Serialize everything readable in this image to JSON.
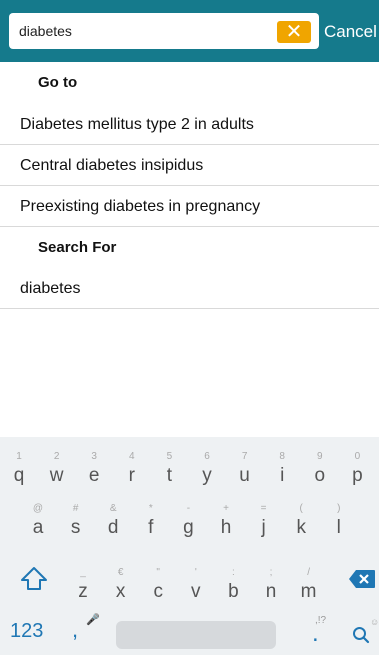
{
  "search": {
    "value": "diabetes",
    "cancel_label": "Cancel",
    "clear_icon": "close-icon"
  },
  "suggestions": {
    "goto_header": "Go to",
    "goto_items": [
      "Diabetes mellitus type 2 in adults",
      "Central diabetes insipidus",
      "Preexisting diabetes in pregnancy"
    ],
    "search_for_header": "Search For",
    "search_for_items": [
      "diabetes"
    ]
  },
  "keyboard": {
    "row1": [
      {
        "hint": "1",
        "key": "q"
      },
      {
        "hint": "2",
        "key": "w"
      },
      {
        "hint": "3",
        "key": "e"
      },
      {
        "hint": "4",
        "key": "r"
      },
      {
        "hint": "5",
        "key": "t"
      },
      {
        "hint": "6",
        "key": "y"
      },
      {
        "hint": "7",
        "key": "u"
      },
      {
        "hint": "8",
        "key": "i"
      },
      {
        "hint": "9",
        "key": "o"
      },
      {
        "hint": "0",
        "key": "p"
      }
    ],
    "row2": [
      {
        "hint": "@",
        "key": "a"
      },
      {
        "hint": "#",
        "key": "s"
      },
      {
        "hint": "&",
        "key": "d"
      },
      {
        "hint": "*",
        "key": "f"
      },
      {
        "hint": "-",
        "key": "g"
      },
      {
        "hint": "+",
        "key": "h"
      },
      {
        "hint": "=",
        "key": "j"
      },
      {
        "hint": "(",
        "key": "k"
      },
      {
        "hint": ")",
        "key": "l"
      }
    ],
    "row3": [
      {
        "hint": "_",
        "key": "z"
      },
      {
        "hint": "€",
        "key": "x"
      },
      {
        "hint": "\"",
        "key": "c"
      },
      {
        "hint": "'",
        "key": "v"
      },
      {
        "hint": ":",
        "key": "b"
      },
      {
        "hint": ";",
        "key": "n"
      },
      {
        "hint": "/",
        "key": "m"
      }
    ],
    "num_label": "123",
    "comma": ",",
    "period": ".",
    "period_hint": ",!?",
    "accent": "#1f77b4"
  },
  "colors": {
    "header_bg": "#157a8c",
    "clear_bg": "#f0a500"
  }
}
